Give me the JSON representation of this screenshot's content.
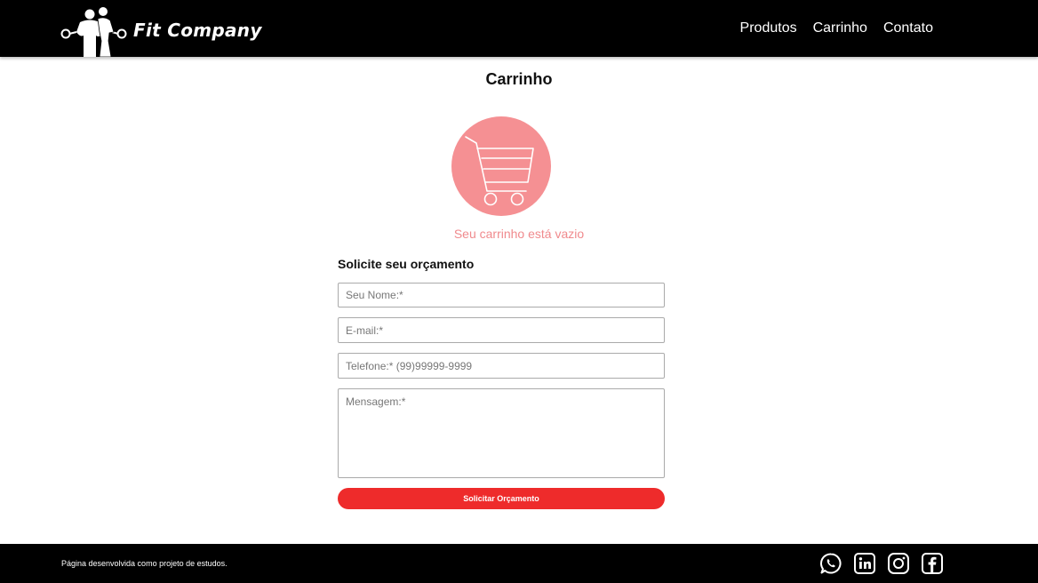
{
  "header": {
    "brand": "Fit Company",
    "nav": [
      {
        "label": "Produtos"
      },
      {
        "label": "Carrinho"
      },
      {
        "label": "Contato"
      }
    ]
  },
  "main": {
    "title": "Carrinho",
    "empty_message": "Seu carrinho está vazio",
    "form": {
      "title": "Solicite seu orçamento",
      "name_placeholder": "Seu Nome:*",
      "email_placeholder": "E-mail:*",
      "phone_placeholder": "Telefone:* (99)99999-9999",
      "message_placeholder": "Mensagem:*",
      "submit_label": "Solicitar Orçamento"
    }
  },
  "footer": {
    "text": "Página desenvolvida como projeto de estudos.",
    "socials": [
      "whatsapp-icon",
      "linkedin-icon",
      "instagram-icon",
      "facebook-icon"
    ]
  },
  "colors": {
    "header_bg": "#000000",
    "accent_red": "#ee2b2b",
    "cart_circle": "#f59093",
    "empty_text": "#f08a8d"
  }
}
